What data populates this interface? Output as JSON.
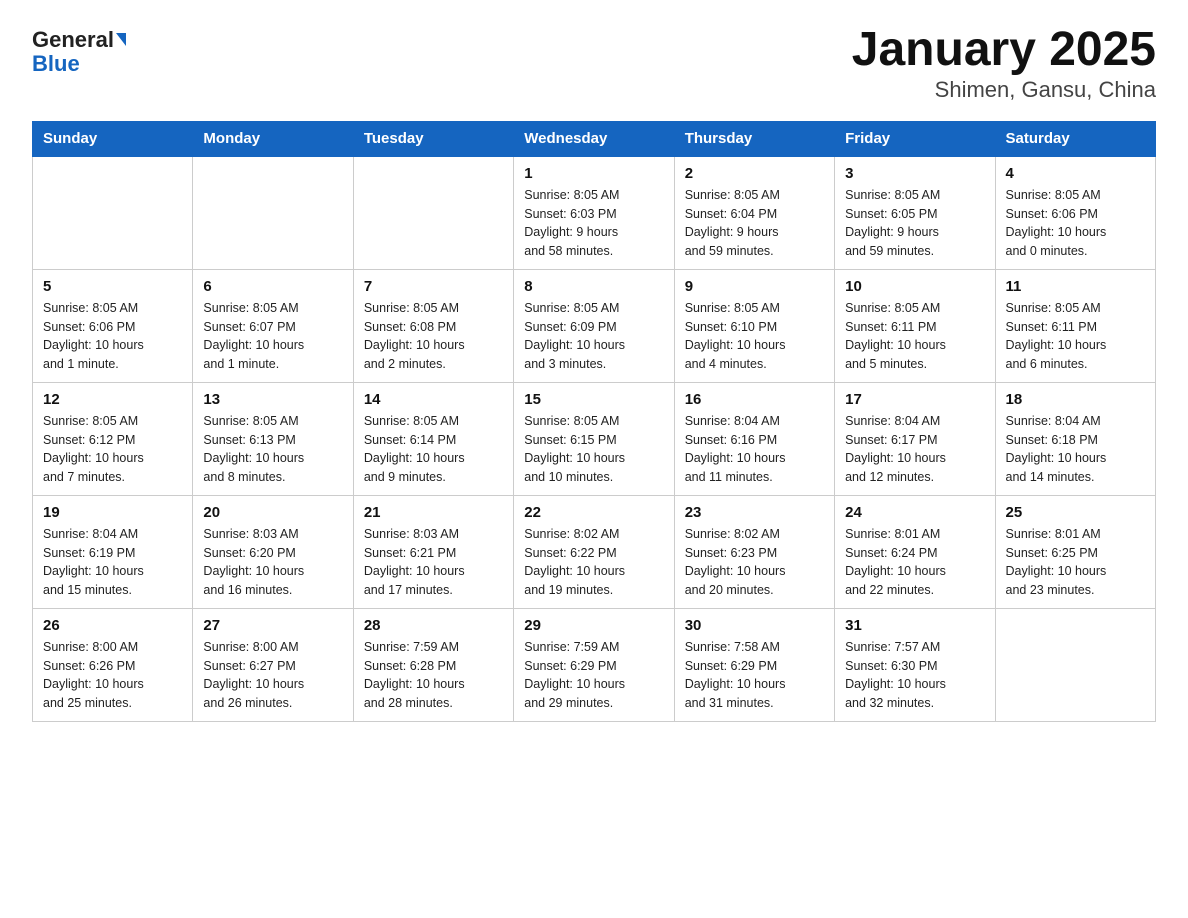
{
  "header": {
    "logo_general": "General",
    "logo_blue": "Blue",
    "title": "January 2025",
    "subtitle": "Shimen, Gansu, China"
  },
  "days_of_week": [
    "Sunday",
    "Monday",
    "Tuesday",
    "Wednesday",
    "Thursday",
    "Friday",
    "Saturday"
  ],
  "weeks": [
    [
      {
        "day": "",
        "info": ""
      },
      {
        "day": "",
        "info": ""
      },
      {
        "day": "",
        "info": ""
      },
      {
        "day": "1",
        "info": "Sunrise: 8:05 AM\nSunset: 6:03 PM\nDaylight: 9 hours\nand 58 minutes."
      },
      {
        "day": "2",
        "info": "Sunrise: 8:05 AM\nSunset: 6:04 PM\nDaylight: 9 hours\nand 59 minutes."
      },
      {
        "day": "3",
        "info": "Sunrise: 8:05 AM\nSunset: 6:05 PM\nDaylight: 9 hours\nand 59 minutes."
      },
      {
        "day": "4",
        "info": "Sunrise: 8:05 AM\nSunset: 6:06 PM\nDaylight: 10 hours\nand 0 minutes."
      }
    ],
    [
      {
        "day": "5",
        "info": "Sunrise: 8:05 AM\nSunset: 6:06 PM\nDaylight: 10 hours\nand 1 minute."
      },
      {
        "day": "6",
        "info": "Sunrise: 8:05 AM\nSunset: 6:07 PM\nDaylight: 10 hours\nand 1 minute."
      },
      {
        "day": "7",
        "info": "Sunrise: 8:05 AM\nSunset: 6:08 PM\nDaylight: 10 hours\nand 2 minutes."
      },
      {
        "day": "8",
        "info": "Sunrise: 8:05 AM\nSunset: 6:09 PM\nDaylight: 10 hours\nand 3 minutes."
      },
      {
        "day": "9",
        "info": "Sunrise: 8:05 AM\nSunset: 6:10 PM\nDaylight: 10 hours\nand 4 minutes."
      },
      {
        "day": "10",
        "info": "Sunrise: 8:05 AM\nSunset: 6:11 PM\nDaylight: 10 hours\nand 5 minutes."
      },
      {
        "day": "11",
        "info": "Sunrise: 8:05 AM\nSunset: 6:11 PM\nDaylight: 10 hours\nand 6 minutes."
      }
    ],
    [
      {
        "day": "12",
        "info": "Sunrise: 8:05 AM\nSunset: 6:12 PM\nDaylight: 10 hours\nand 7 minutes."
      },
      {
        "day": "13",
        "info": "Sunrise: 8:05 AM\nSunset: 6:13 PM\nDaylight: 10 hours\nand 8 minutes."
      },
      {
        "day": "14",
        "info": "Sunrise: 8:05 AM\nSunset: 6:14 PM\nDaylight: 10 hours\nand 9 minutes."
      },
      {
        "day": "15",
        "info": "Sunrise: 8:05 AM\nSunset: 6:15 PM\nDaylight: 10 hours\nand 10 minutes."
      },
      {
        "day": "16",
        "info": "Sunrise: 8:04 AM\nSunset: 6:16 PM\nDaylight: 10 hours\nand 11 minutes."
      },
      {
        "day": "17",
        "info": "Sunrise: 8:04 AM\nSunset: 6:17 PM\nDaylight: 10 hours\nand 12 minutes."
      },
      {
        "day": "18",
        "info": "Sunrise: 8:04 AM\nSunset: 6:18 PM\nDaylight: 10 hours\nand 14 minutes."
      }
    ],
    [
      {
        "day": "19",
        "info": "Sunrise: 8:04 AM\nSunset: 6:19 PM\nDaylight: 10 hours\nand 15 minutes."
      },
      {
        "day": "20",
        "info": "Sunrise: 8:03 AM\nSunset: 6:20 PM\nDaylight: 10 hours\nand 16 minutes."
      },
      {
        "day": "21",
        "info": "Sunrise: 8:03 AM\nSunset: 6:21 PM\nDaylight: 10 hours\nand 17 minutes."
      },
      {
        "day": "22",
        "info": "Sunrise: 8:02 AM\nSunset: 6:22 PM\nDaylight: 10 hours\nand 19 minutes."
      },
      {
        "day": "23",
        "info": "Sunrise: 8:02 AM\nSunset: 6:23 PM\nDaylight: 10 hours\nand 20 minutes."
      },
      {
        "day": "24",
        "info": "Sunrise: 8:01 AM\nSunset: 6:24 PM\nDaylight: 10 hours\nand 22 minutes."
      },
      {
        "day": "25",
        "info": "Sunrise: 8:01 AM\nSunset: 6:25 PM\nDaylight: 10 hours\nand 23 minutes."
      }
    ],
    [
      {
        "day": "26",
        "info": "Sunrise: 8:00 AM\nSunset: 6:26 PM\nDaylight: 10 hours\nand 25 minutes."
      },
      {
        "day": "27",
        "info": "Sunrise: 8:00 AM\nSunset: 6:27 PM\nDaylight: 10 hours\nand 26 minutes."
      },
      {
        "day": "28",
        "info": "Sunrise: 7:59 AM\nSunset: 6:28 PM\nDaylight: 10 hours\nand 28 minutes."
      },
      {
        "day": "29",
        "info": "Sunrise: 7:59 AM\nSunset: 6:29 PM\nDaylight: 10 hours\nand 29 minutes."
      },
      {
        "day": "30",
        "info": "Sunrise: 7:58 AM\nSunset: 6:29 PM\nDaylight: 10 hours\nand 31 minutes."
      },
      {
        "day": "31",
        "info": "Sunrise: 7:57 AM\nSunset: 6:30 PM\nDaylight: 10 hours\nand 32 minutes."
      },
      {
        "day": "",
        "info": ""
      }
    ]
  ]
}
